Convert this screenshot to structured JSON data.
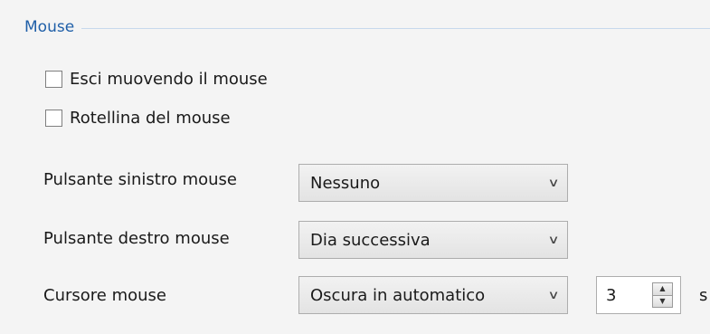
{
  "group": {
    "title": "Mouse"
  },
  "checkboxes": [
    {
      "label": "Esci muovendo il mouse",
      "checked": false
    },
    {
      "label": "Rotellina del mouse",
      "checked": false
    }
  ],
  "fields": {
    "left_button": {
      "label": "Pulsante sinistro mouse",
      "value": "Nessuno"
    },
    "right_button": {
      "label": "Pulsante destro mouse",
      "value": "Dia successiva"
    },
    "cursor": {
      "label": "Cursore mouse",
      "value": "Oscura in automatico",
      "seconds_value": "3",
      "seconds_unit": "s"
    }
  },
  "icons": {
    "dropdown": "chevron-down-icon",
    "spin_up": "spin-up-icon",
    "spin_down": "spin-down-icon"
  },
  "colors": {
    "group_title": "#1f5fa8",
    "group_line": "#c7d9ec",
    "background": "#f4f4f4"
  }
}
